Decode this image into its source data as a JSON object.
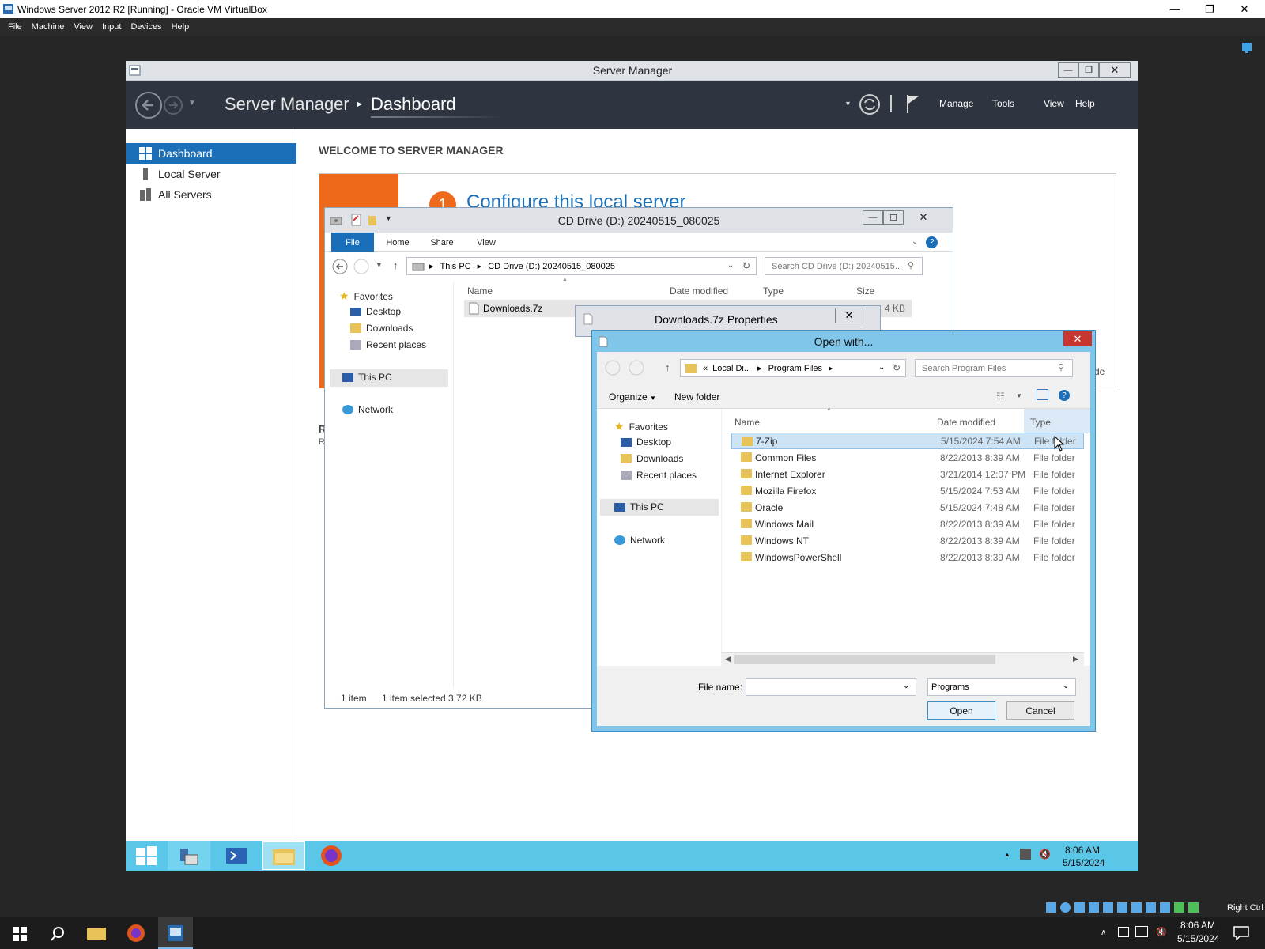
{
  "vbox": {
    "title": "Windows Server 2012 R2 [Running] - Oracle VM VirtualBox",
    "menu": [
      "File",
      "Machine",
      "View",
      "Input",
      "Devices",
      "Help"
    ],
    "host_key": "Right Ctrl"
  },
  "server_manager": {
    "window_title": "Server Manager",
    "breadcrumb_app": "Server Manager",
    "breadcrumb_page": "Dashboard",
    "menu": [
      "Manage",
      "Tools",
      "View",
      "Help"
    ],
    "nav": [
      "Dashboard",
      "Local Server",
      "All Servers"
    ],
    "welcome": "WELCOME TO SERVER MANAGER",
    "step_number": "1",
    "step_text": "Configure this local server",
    "clipped_side_letters": [
      "R",
      "R"
    ],
    "clipped_right_text": "de"
  },
  "explorer": {
    "title": "CD Drive (D:) 20240515_080025",
    "ribbon_tabs": [
      "File",
      "Home",
      "Share",
      "View"
    ],
    "path": [
      "This PC",
      "CD Drive (D:) 20240515_080025"
    ],
    "search_placeholder": "Search CD Drive (D:) 20240515...",
    "tree": {
      "favorites": "Favorites",
      "desktop": "Desktop",
      "downloads": "Downloads",
      "recent": "Recent places",
      "thispc": "This PC",
      "network": "Network"
    },
    "columns": [
      "Name",
      "Date modified",
      "Type",
      "Size"
    ],
    "file": {
      "name": "Downloads.7z",
      "size": "4 KB"
    },
    "status": {
      "count": "1 item",
      "selected": "1 item selected  3.72 KB"
    }
  },
  "properties": {
    "title": "Downloads.7z Properties"
  },
  "open_with": {
    "title": "Open with...",
    "path": [
      "Local Di...",
      "Program Files"
    ],
    "path_prefix": "«",
    "search_placeholder": "Search Program Files",
    "organize": "Organize",
    "new_folder": "New folder",
    "tree": {
      "favorites": "Favorites",
      "desktop": "Desktop",
      "downloads": "Downloads",
      "recent": "Recent places",
      "thispc": "This PC",
      "network": "Network"
    },
    "columns": [
      "Name",
      "Date modified",
      "Type"
    ],
    "rows": [
      {
        "name": "7-Zip",
        "date": "5/15/2024 7:54 AM",
        "type": "File folder"
      },
      {
        "name": "Common Files",
        "date": "8/22/2013 8:39 AM",
        "type": "File folder"
      },
      {
        "name": "Internet Explorer",
        "date": "3/21/2014 12:07 PM",
        "type": "File folder"
      },
      {
        "name": "Mozilla Firefox",
        "date": "5/15/2024 7:53 AM",
        "type": "File folder"
      },
      {
        "name": "Oracle",
        "date": "5/15/2024 7:48 AM",
        "type": "File folder"
      },
      {
        "name": "Windows Mail",
        "date": "8/22/2013 8:39 AM",
        "type": "File folder"
      },
      {
        "name": "Windows NT",
        "date": "8/22/2013 8:39 AM",
        "type": "File folder"
      },
      {
        "name": "WindowsPowerShell",
        "date": "8/22/2013 8:39 AM",
        "type": "File folder"
      }
    ],
    "file_name_label": "File name:",
    "file_name_value": "",
    "filter": "Programs",
    "open_btn": "Open",
    "cancel_btn": "Cancel"
  },
  "guest_clock": {
    "time": "8:06 AM",
    "date": "5/15/2024"
  },
  "host_clock": {
    "time": "8:06 AM",
    "date": "5/15/2024"
  }
}
